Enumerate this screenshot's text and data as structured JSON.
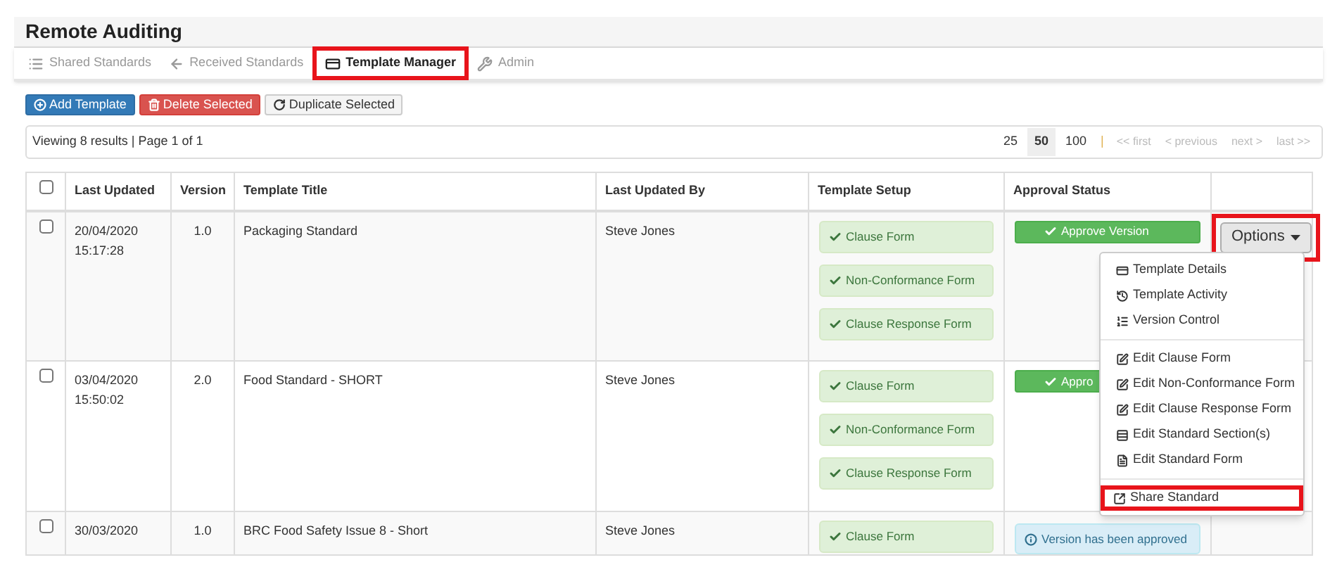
{
  "app_title": "Remote Auditing",
  "tabs": [
    {
      "label": "Shared Standards",
      "selected": false,
      "highlighted": false
    },
    {
      "label": "Received Standards",
      "selected": false,
      "highlighted": false
    },
    {
      "label": "Template Manager",
      "selected": true,
      "highlighted": true
    },
    {
      "label": "Admin",
      "selected": false,
      "highlighted": false
    }
  ],
  "toolbar": [
    {
      "label": "Add Template",
      "kind": "primary"
    },
    {
      "label": "Delete Selected",
      "kind": "danger"
    },
    {
      "label": "Duplicate Selected",
      "kind": "default"
    }
  ],
  "results": "Viewing 8 results | Page 1 of 1",
  "page_sizes": [
    {
      "label": "25",
      "selected": false
    },
    {
      "label": "50",
      "selected": true
    },
    {
      "label": "100",
      "selected": false
    }
  ],
  "pager_separator": "|",
  "pager": [
    {
      "label": "<< first",
      "disabled": true
    },
    {
      "label": "< previous",
      "disabled": true
    },
    {
      "label": "next >",
      "disabled": true
    },
    {
      "label": "last >>",
      "disabled": true
    }
  ],
  "table": {
    "select_all": {
      "checked": false
    },
    "columns": [
      "Last Updated",
      "Version",
      "Template Title",
      "Last Updated By",
      "Template Setup",
      "Approval Status"
    ],
    "rows": [
      {
        "checked": false,
        "last_updated": [
          "20/04/2020",
          "15:17:28"
        ],
        "version": "1.0",
        "title": "Packaging Standard",
        "updated_by": "Steve Jones",
        "setup": [
          "Clause Form",
          "Non-Conformance Form",
          "Clause Response Form"
        ],
        "approval": {
          "kind": "approve",
          "label": "Approve Version"
        },
        "options": {
          "label": "Options",
          "highlighted": true
        }
      },
      {
        "checked": false,
        "last_updated": [
          "03/04/2020",
          "15:50:02"
        ],
        "version": "2.0",
        "title": "Food Standard - SHORT",
        "updated_by": "Steve Jones",
        "setup": [
          "Clause Form",
          "Non-Conformance Form",
          "Clause Response Form"
        ],
        "approval": {
          "kind": "approve",
          "label": "Appro"
        }
      },
      {
        "checked": false,
        "last_updated": [
          "30/03/2020"
        ],
        "version": "1.0",
        "title": "BRC Food Safety Issue 8 - Short",
        "updated_by": "Steve Jones",
        "setup": [
          "Clause Form"
        ],
        "approval": {
          "kind": "info",
          "label": "Version has been approved"
        }
      }
    ]
  },
  "menu": {
    "groups": [
      [
        {
          "label": "Template Details",
          "highlighted": false
        },
        {
          "label": "Template Activity",
          "highlighted": false
        },
        {
          "label": "Version Control",
          "highlighted": false
        }
      ],
      [
        {
          "label": "Edit Clause Form",
          "highlighted": false
        },
        {
          "label": "Edit Non-Conformance Form",
          "highlighted": false
        },
        {
          "label": "Edit Clause Response Form",
          "highlighted": false
        },
        {
          "label": "Edit Standard Section(s)",
          "highlighted": false
        },
        {
          "label": "Edit Standard Form",
          "highlighted": false
        }
      ],
      [
        {
          "label": "Share Standard",
          "highlighted": true
        }
      ]
    ]
  }
}
